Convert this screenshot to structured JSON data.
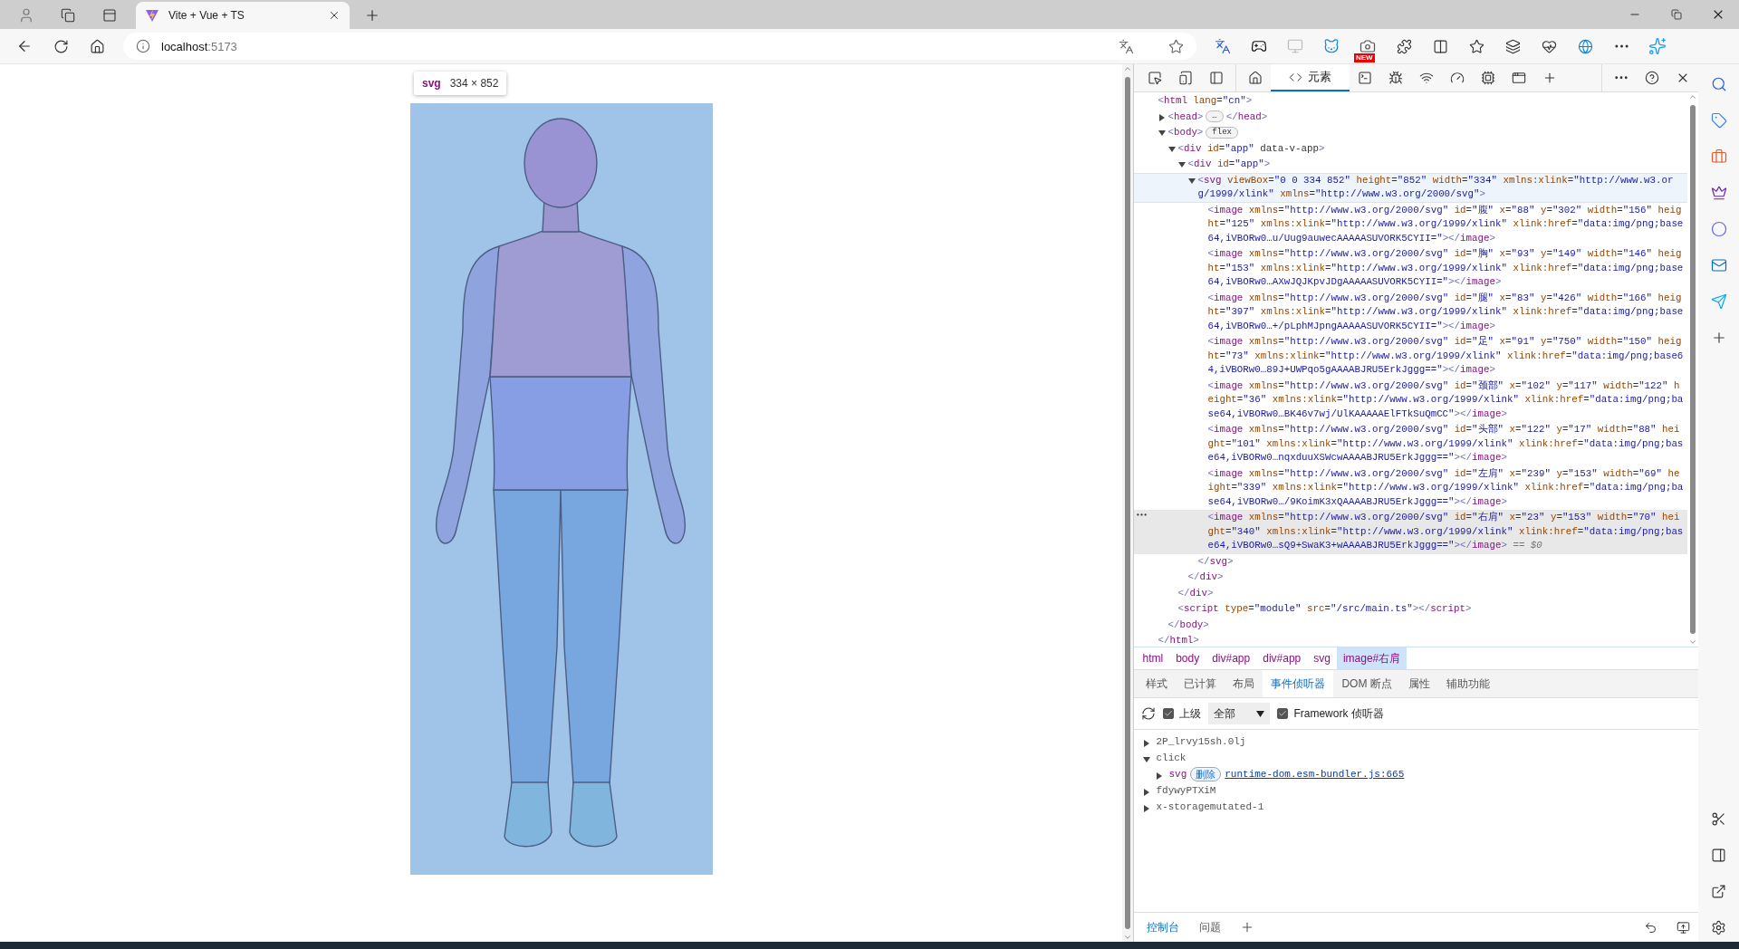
{
  "browser": {
    "tab": {
      "title": "Vite + Vue + TS",
      "selected": true
    },
    "address": {
      "host": "localhost",
      "port": ":5173"
    },
    "extension_badge": "NEW"
  },
  "page": {
    "tooltip": {
      "tag": "svg",
      "size": "334 × 852"
    }
  },
  "devtools": {
    "panel_tab": {
      "label": "元素",
      "selected": true
    },
    "dom_tree": [
      {
        "open": "<html lang=\"cn\">",
        "close": "</html>",
        "hovered": false,
        "selected": false,
        "children": [
          {
            "open": "<head>",
            "ellipsis": "…",
            "close": "</head>",
            "expanded": false,
            "hovered": false,
            "selected": false
          },
          {
            "open": "<body>",
            "badge": "flex",
            "close": "</body>",
            "expanded": true,
            "hovered": false,
            "selected": false,
            "children": [
              {
                "open": "<div id=\"app\" data-v-app>",
                "close": "</div>",
                "expanded": true,
                "hovered": false,
                "selected": false,
                "children": [
                  {
                    "open": "<div id=\"app\">",
                    "close": "</div>",
                    "expanded": true,
                    "hovered": false,
                    "selected": false,
                    "children": [
                      {
                        "open": "<svg viewBox=\"0 0 334 852\" height=\"852\" width=\"334\" xmlns:xlink=\"http://www.w3.org/1999/xlink\" xmlns=\"http://www.w3.org/2000/svg\">",
                        "close": "</svg>",
                        "expanded": true,
                        "hovered": true,
                        "selected": false,
                        "children": [
                          {
                            "open": "<image xmlns=\"http://www.w3.org/2000/svg\" id=\"腹\" x=\"88\" y=\"302\" width=\"156\" height=\"125\" xmlns:xlink=\"http://www.w3.org/1999/xlink\" xlink:href=\"data:img/png;base64,iVBORw0…u/Uug9auwecAAAAASUVORK5CYII=\">",
                            "close": "</image>",
                            "hovered": false,
                            "selected": false
                          },
                          {
                            "open": "<image xmlns=\"http://www.w3.org/2000/svg\" id=\"胸\" x=\"93\" y=\"149\" width=\"146\" height=\"153\" xmlns:xlink=\"http://www.w3.org/1999/xlink\" xlink:href=\"data:img/png;base64,iVBORw0…AXwJQJKpvJDgAAAAASUVORK5CYII=\">",
                            "close": "</image>",
                            "hovered": false,
                            "selected": false
                          },
                          {
                            "open": "<image xmlns=\"http://www.w3.org/2000/svg\" id=\"腿\" x=\"83\" y=\"426\" width=\"166\" height=\"397\" xmlns:xlink=\"http://www.w3.org/1999/xlink\" xlink:href=\"data:img/png;base64,iVBORw0…+/pLphMJpngAAAAASUVORK5CYII=\">",
                            "close": "</image>",
                            "hovered": false,
                            "selected": false
                          },
                          {
                            "open": "<image xmlns=\"http://www.w3.org/2000/svg\" id=\"足\" x=\"91\" y=\"750\" width=\"150\" height=\"73\" xmlns:xlink=\"http://www.w3.org/1999/xlink\" xlink:href=\"data:img/png;base64,iVBORw0…89J+UWPqo5gAAAABJRU5ErkJggg==\">",
                            "close": "</image>",
                            "hovered": false,
                            "selected": false
                          },
                          {
                            "open": "<image xmlns=\"http://www.w3.org/2000/svg\" id=\"颈部\" x=\"102\" y=\"117\" width=\"122\" height=\"36\" xmlns:xlink=\"http://www.w3.org/1999/xlink\" xlink:href=\"data:img/png;base64,iVBORw0…BK46v7wj/UlKAAAAAElFTkSuQmCC\">",
                            "close": "</image>",
                            "hovered": false,
                            "selected": false
                          },
                          {
                            "open": "<image xmlns=\"http://www.w3.org/2000/svg\" id=\"头部\" x=\"122\" y=\"17\" width=\"88\" height=\"101\" xmlns:xlink=\"http://www.w3.org/1999/xlink\" xlink:href=\"data:img/png;base64,iVBORw0…nqxduuXSWcwAAAABJRU5ErkJggg==\">",
                            "close": "</image>",
                            "hovered": false,
                            "selected": false
                          },
                          {
                            "open": "<image xmlns=\"http://www.w3.org/2000/svg\" id=\"左肩\" x=\"239\" y=\"153\" width=\"69\" height=\"339\" xmlns:xlink=\"http://www.w3.org/1999/xlink\" xlink:href=\"data:img/png;base64,iVBORw0…/9KoimK3xQAAAABJRU5ErkJggg==\">",
                            "close": "</image>",
                            "hovered": false,
                            "selected": false
                          },
                          {
                            "open": "<image xmlns=\"http://www.w3.org/2000/svg\" id=\"右肩\" x=\"23\" y=\"153\" width=\"70\" height=\"340\" xmlns:xlink=\"http://www.w3.org/1999/xlink\" xlink:href=\"data:img/png;base64,iVBORw0…sQ9+SwaK3+wAAAABJRU5ErkJggg==\">",
                            "close": "</image>",
                            "suffix": "== $0",
                            "hovered": false,
                            "selected": true
                          }
                        ]
                      }
                    ]
                  }
                ]
              },
              {
                "open": "<script type=\"module\" src=\"/src/main.ts\">",
                "close": "</script>",
                "hovered": false,
                "selected": false
              }
            ]
          }
        ]
      }
    ],
    "breadcrumbs": [
      {
        "label": "html",
        "selected": false
      },
      {
        "label": "body",
        "selected": false
      },
      {
        "label": "div#app",
        "selected": false
      },
      {
        "label": "div#app",
        "selected": false
      },
      {
        "label": "svg",
        "selected": false
      },
      {
        "label": "image#右肩",
        "selected": true
      }
    ],
    "sub_tabs": [
      {
        "label": "样式",
        "selected": false
      },
      {
        "label": "已计算",
        "selected": false
      },
      {
        "label": "布局",
        "selected": false
      },
      {
        "label": "事件侦听器",
        "selected": true
      },
      {
        "label": "DOM 断点",
        "selected": false
      },
      {
        "label": "属性",
        "selected": false
      },
      {
        "label": "辅助功能",
        "selected": false
      }
    ],
    "filter": {
      "ancestors": {
        "label": "上级",
        "checked": true
      },
      "select": {
        "value": "全部"
      },
      "framework": {
        "label": "Framework 侦听器",
        "checked": true
      }
    },
    "listeners": [
      {
        "label": "2P_lrvy15sh.0lj",
        "expanded": false
      },
      {
        "label": "click",
        "expanded": true,
        "children": [
          {
            "label": "svg",
            "expanded": false,
            "action": "删除",
            "link": "runtime-dom.esm-bundler.js:665"
          }
        ]
      },
      {
        "label": "fdywyPTXiM",
        "expanded": false
      },
      {
        "label": "x-storagemutated-1",
        "expanded": false
      }
    ],
    "drawer_tabs": [
      {
        "label": "控制台",
        "selected": true
      },
      {
        "label": "问题",
        "selected": false
      }
    ]
  }
}
